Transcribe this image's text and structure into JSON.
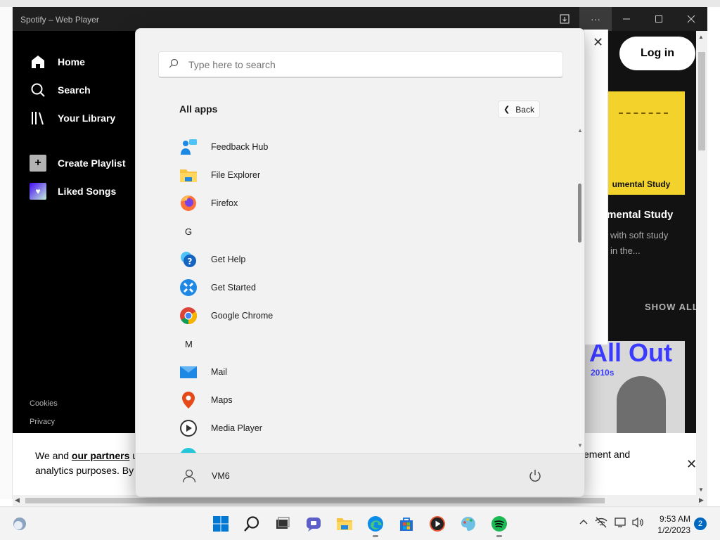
{
  "spotify": {
    "window_title": "Spotify – Web Player",
    "nav": {
      "home": "Home",
      "search": "Search",
      "library": "Your Library",
      "create_playlist": "Create Playlist",
      "liked_songs": "Liked Songs"
    },
    "footer": {
      "cookies": "Cookies",
      "privacy": "Privacy"
    },
    "login_label": "Log in",
    "card1": {
      "caption": "umental Study",
      "title": "umental Study",
      "desc_line1": "with soft study",
      "desc_line2": "in the..."
    },
    "show_all": "SHOW ALL",
    "card2": {
      "title": "All Out",
      "subtitle": "2010s"
    },
    "cookie": {
      "line1_a": "We and ",
      "partners": "our partners",
      "line1_b": " u",
      "line2": "analytics purposes. By",
      "right": "ement and"
    }
  },
  "start_menu": {
    "search_placeholder": "Type here to search",
    "heading": "All apps",
    "back_label": "Back",
    "apps": [
      {
        "label": "Feedback Hub",
        "icon": "feedback-hub-icon"
      },
      {
        "label": "File Explorer",
        "icon": "file-explorer-icon"
      },
      {
        "label": "Firefox",
        "icon": "firefox-icon"
      },
      {
        "letter": "G"
      },
      {
        "label": "Get Help",
        "icon": "get-help-icon"
      },
      {
        "label": "Get Started",
        "icon": "get-started-icon"
      },
      {
        "label": "Google Chrome",
        "icon": "chrome-icon"
      },
      {
        "letter": "M"
      },
      {
        "label": "Mail",
        "icon": "mail-icon"
      },
      {
        "label": "Maps",
        "icon": "maps-icon"
      },
      {
        "label": "Media Player",
        "icon": "media-player-icon"
      }
    ],
    "user_name": "VM6"
  },
  "taskbar": {
    "time": "9:53 AM",
    "date": "1/2/2023",
    "notification_count": "2"
  },
  "colors": {
    "spotify_bg": "#121212",
    "start_menu_bg": "#f2f2f2",
    "accent_blue": "#0067c0"
  }
}
